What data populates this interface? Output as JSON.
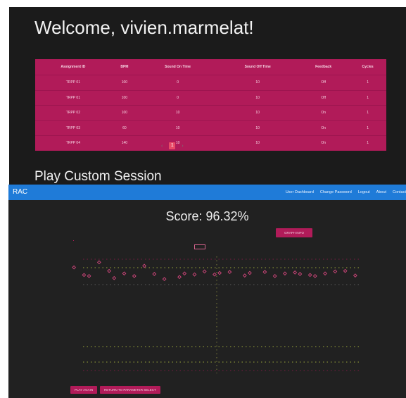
{
  "welcome": "Welcome, vivien.marmelat!",
  "table": {
    "headers": [
      "Assignment ID",
      "BPM",
      "Sound On Time",
      "Sound Off Time",
      "Feedback",
      "Cycles"
    ],
    "rows": [
      [
        "TRPP 01",
        "100",
        "0",
        "10",
        "Off",
        "1"
      ],
      [
        "TRPP 01",
        "100",
        "0",
        "10",
        "Off",
        "1"
      ],
      [
        "TRPP 02",
        "100",
        "10",
        "10",
        "On",
        "1"
      ],
      [
        "TRPP 03",
        "60",
        "10",
        "10",
        "On",
        "1"
      ],
      [
        "TRPP 04",
        "140",
        "10",
        "10",
        "On",
        "1"
      ]
    ]
  },
  "pager": {
    "prev": "‹",
    "page": "1",
    "next": "›"
  },
  "section_title": "Play Custom Session",
  "navbar": {
    "brand": "RAC",
    "links": [
      "User Dashboard",
      "Change Password",
      "Logout",
      "About",
      "Contact"
    ]
  },
  "score": "Score: 96.32%",
  "graph_info_label": "GRAPH INFO",
  "buttons": {
    "play_again": "PLAY AGAIN",
    "return": "RETURN TO PARAMETER SELECT"
  },
  "colors": {
    "accent": "#b11b59",
    "navbar": "#1f7bd8",
    "background": "#212121"
  },
  "chart_data": {
    "type": "scatter",
    "points": [
      [
        0.5,
        520
      ],
      [
        1.5,
        505
      ],
      [
        2,
        503
      ],
      [
        3,
        530
      ],
      [
        4,
        513
      ],
      [
        4.5,
        499
      ],
      [
        5.5,
        508
      ],
      [
        6.5,
        503
      ],
      [
        7.5,
        523
      ],
      [
        8.5,
        507
      ],
      [
        9.5,
        497
      ],
      [
        11,
        501
      ],
      [
        11.5,
        508
      ],
      [
        12.5,
        506
      ],
      [
        13.5,
        512
      ],
      [
        14.5,
        506
      ],
      [
        15,
        509
      ],
      [
        16,
        511
      ],
      [
        17.5,
        504
      ],
      [
        18,
        509
      ],
      [
        19.5,
        511
      ],
      [
        20.5,
        503
      ],
      [
        21.5,
        508
      ],
      [
        22.5,
        510
      ],
      [
        23,
        507
      ],
      [
        24,
        505
      ],
      [
        24.5,
        503
      ],
      [
        25.5,
        508
      ],
      [
        26.5,
        512
      ],
      [
        27.5,
        513
      ],
      [
        28.5,
        504
      ]
    ],
    "ylim": [
      300,
      550
    ],
    "xlim": [
      0,
      29
    ],
    "grid": true
  }
}
